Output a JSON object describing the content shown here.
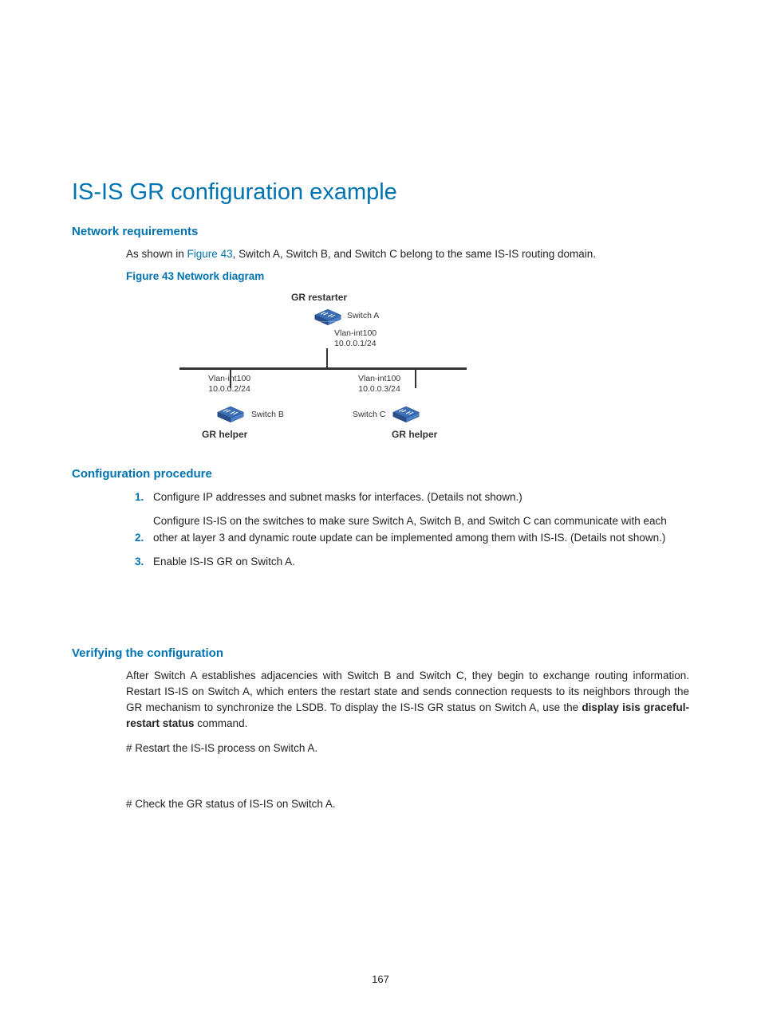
{
  "page": {
    "title": "IS-IS GR configuration example",
    "sections": {
      "network_requirements": {
        "heading": "Network requirements",
        "text_prefix": "As shown in ",
        "figure_link": "Figure 43",
        "text_suffix": ", Switch A, Switch B, and Switch C belong to the same IS-IS routing domain.",
        "figure_caption": "Figure 43 Network diagram"
      },
      "configuration_procedure": {
        "heading": "Configuration procedure",
        "steps": [
          "Configure IP addresses and subnet masks for interfaces. (Details not shown.)",
          "Configure IS-IS on the switches to make sure Switch A, Switch B, and Switch C can communicate with each other at layer 3 and dynamic route update can be implemented among them with IS-IS. (Details not shown.)",
          "Enable IS-IS GR on Switch A."
        ]
      },
      "verifying": {
        "heading": "Verifying the configuration",
        "text_prefix": "After Switch A establishes adjacencies with Switch B and Switch C, they begin to exchange routing information. Restart IS-IS on Switch A, which enters the restart state and sends connection requests to its neighbors through the GR mechanism to synchronize the LSDB. To display the IS-IS GR status on Switch A, use the ",
        "bold_command": "display isis graceful-restart status",
        "text_suffix": " command.",
        "hash1": "# Restart the IS-IS process on Switch A.",
        "hash2": "# Check the GR status of IS-IS on Switch A."
      }
    },
    "diagram": {
      "top_label": "GR restarter",
      "switch_a": "Switch A",
      "switch_b": "Switch B",
      "switch_c": "Switch C",
      "vlan_a": "Vlan-int100\n10.0.0.1/24",
      "vlan_b": "Vlan-int100\n10.0.0.2/24",
      "vlan_c": "Vlan-int100\n10.0.0.3/24",
      "gr_helper_left": "GR helper",
      "gr_helper_right": "GR helper"
    },
    "page_number": "167"
  }
}
